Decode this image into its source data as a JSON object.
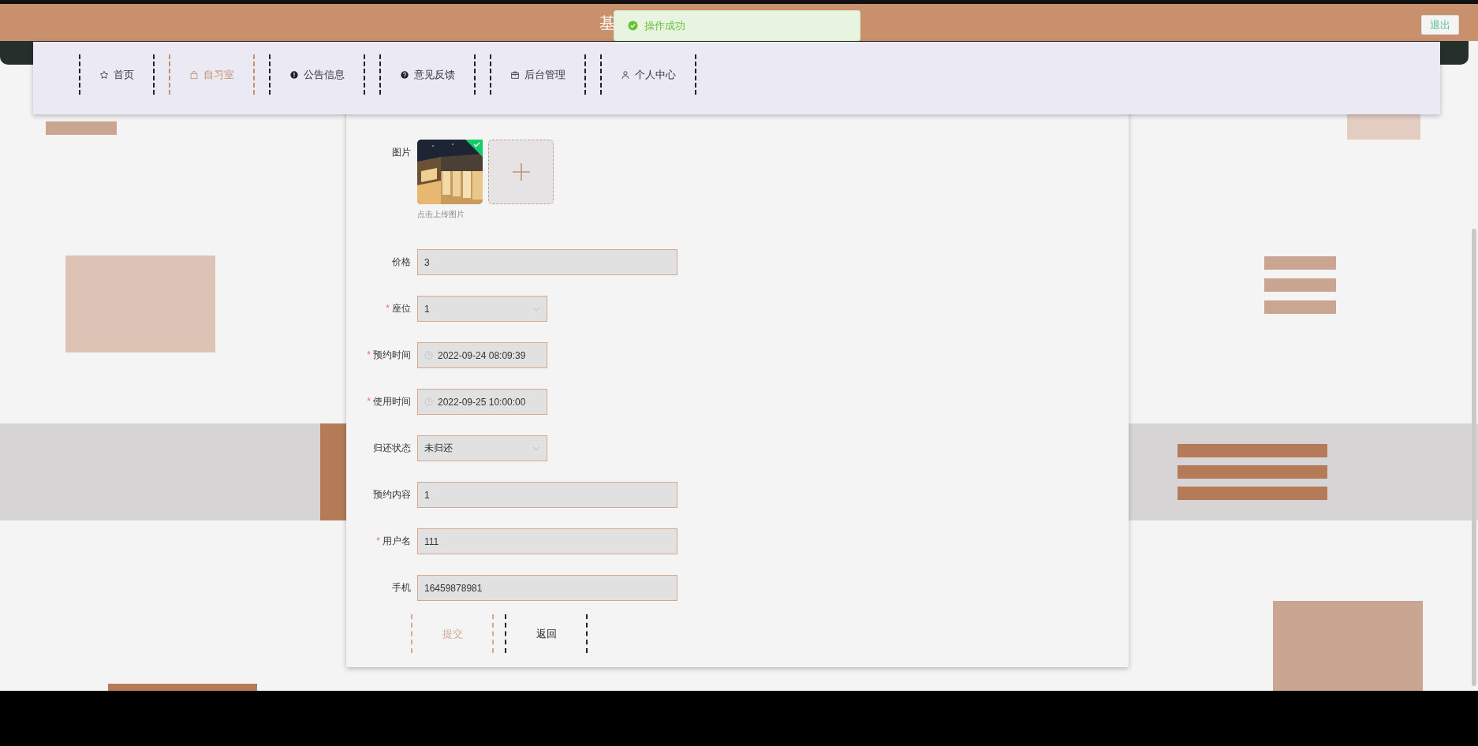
{
  "header": {
    "title": "基",
    "logout": "退出"
  },
  "toast": {
    "message": "操作成功"
  },
  "nav": [
    {
      "label": "首页",
      "selected": false
    },
    {
      "label": "自习室",
      "selected": true
    },
    {
      "label": "公告信息",
      "selected": false
    },
    {
      "label": "意见反馈",
      "selected": false
    },
    {
      "label": "后台管理",
      "selected": false
    },
    {
      "label": "个人中心",
      "selected": false
    }
  ],
  "form": {
    "required_mark": "*",
    "fields": [
      {
        "label": "图片",
        "hint": "点击上传图片"
      },
      {
        "kind": "text",
        "label": "价格",
        "value": "3",
        "required": false
      },
      {
        "kind": "select",
        "label": "座位",
        "value": "1",
        "required": true
      },
      {
        "kind": "datetime",
        "label": "预约时间",
        "value": "2022-09-24 08:09:39",
        "required": true
      },
      {
        "kind": "datetime",
        "label": "使用时间",
        "value": "2022-09-25 10:00:00",
        "required": true
      },
      {
        "kind": "select",
        "label": "归还状态",
        "value": "未归还",
        "required": false
      },
      {
        "kind": "text",
        "label": "预约内容",
        "value": "1",
        "required": false
      },
      {
        "kind": "text",
        "label": "用户名",
        "value": "111",
        "required": true
      },
      {
        "kind": "text",
        "label": "手机",
        "value": "16459878981",
        "required": false
      }
    ],
    "buttons": [
      {
        "label": "提交",
        "kind": "primary"
      },
      {
        "label": "返回",
        "kind": "default"
      }
    ]
  }
}
